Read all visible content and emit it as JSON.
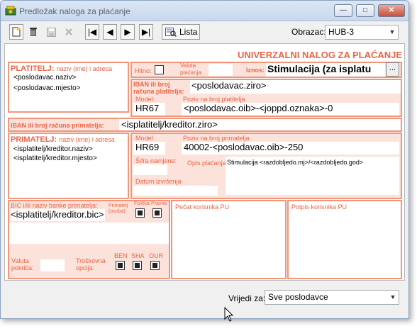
{
  "window": {
    "title": "Predložak naloga za plaćanje",
    "min_glyph": "—",
    "max_glyph": "□",
    "close_glyph": "✕"
  },
  "toolbar": {
    "new_icon": "document-new-icon",
    "delete_icon": "trash-icon",
    "save_icon": "save-icon",
    "cancel_icon": "close-icon",
    "first_glyph": "|◀",
    "prev_glyph": "◀",
    "next_glyph": "▶",
    "last_glyph": "▶|",
    "lista_label": "Lista",
    "obrazac_label": "Obrazac:",
    "obrazac_value": "HUB-3"
  },
  "form": {
    "heading": "UNIVERZALNI NALOG ZA PLAĆANJE",
    "platitelj_label": "PLATITELJ:",
    "platitelj_hint": "naziv (ime) i adresa",
    "platitelj_line1": "<poslodavac.naziv>",
    "platitelj_line2": "<poslodavac.mjesto>",
    "hitno_label": "Hitno:",
    "valuta_placanja_label": "Valuta plaćanja",
    "iznos_label": "Iznos:",
    "iznos_value": "Stimulacija (za isplatu",
    "ellipsis_label": "...",
    "iban_platitelja_label": "IBAN ili broj računa platitelja:",
    "iban_platitelja_value": "<poslodavac.ziro>",
    "model_label": "Model:",
    "model1_value": "HR67",
    "poziv_platitelja_label": "Poziv na broj platitelja",
    "poziv_platitelja_value": "<poslodavac.oib>-<joppd.oznaka>-0",
    "iban_primatelja_label": "IBAN ili broj računa primatelja:",
    "iban_primatelja_value": "<isplatitelj/kreditor.ziro>",
    "primatelj_label": "PRIMATELJ:",
    "primatelj_hint": "naziv (ime) i adresa",
    "primatelj_line1": "<isplatitelj/kreditor.naziv>",
    "primatelj_line2": "<isplatitelj/kreditor.mjesto>",
    "model2_label": "Model",
    "model2_value": "HR69",
    "poziv_primatelja_label": "Poziv na broj primatelja",
    "poziv_primatelja_value": "40002-<poslodavac.oib>-250",
    "sifra_namjene_label": "Šifra namjene:",
    "opis_placanja_label": "Opis plaćanja:",
    "opis_placanja_value": "Stimulacija <razdobljedo.mj>/<razdobljedo.god>",
    "datum_izvrsenja_label": "Datum izvršenja",
    "bic_label": "BIC i/ili naziv banke primatelja:",
    "primatelj_osoba_label": "Primatelj (osoba)",
    "fizicka_label": "Fizička",
    "pravna_label": "Pravna",
    "bic_value": "<isplatitelj/kreditor.bic>",
    "valuta_pokrica_label": "Valuta pokrića:",
    "troskovna_label": "Troškovna opcija:",
    "ben_label": "BEN",
    "sha_label": "SHA",
    "our_label": "OUR",
    "pecat_label": "Pečat korisnika PU",
    "potpis_label": "Potpis korisnika PU"
  },
  "footer": {
    "vrijedi_label": "Vrijedi za:",
    "vrijedi_value": "Sve poslodavce"
  },
  "colors": {
    "accent": "#ea6547",
    "border": "#f1957b",
    "fill": "#fbe3dc"
  }
}
